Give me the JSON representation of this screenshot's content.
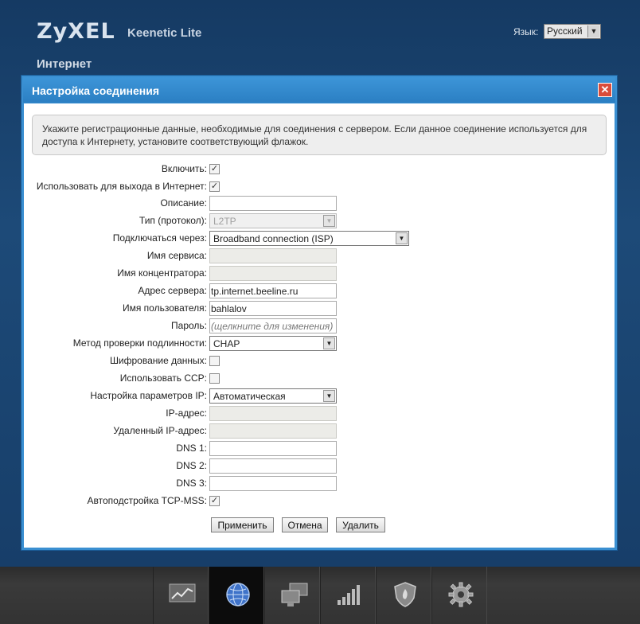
{
  "header": {
    "logo": "ZyXEL",
    "model": "Keenetic Lite",
    "language_label": "Язык:",
    "language_value": "Русский",
    "section": "Интернет"
  },
  "dialog": {
    "title": "Настройка соединения",
    "close": "✕",
    "notice": "Укажите регистрационные данные, необходимые для соединения с сервером. Если данное соединение используется для доступа к Интернету, установите соответствующий флажок."
  },
  "form": {
    "enable": {
      "label": "Включить:",
      "checked": true
    },
    "use_internet": {
      "label": "Использовать для выхода в Интернет:",
      "checked": true
    },
    "description": {
      "label": "Описание:",
      "value": ""
    },
    "protocol": {
      "label": "Тип (протокол):",
      "value": "L2TP"
    },
    "via": {
      "label": "Подключаться через:",
      "value": "Broadband connection (ISP)"
    },
    "service_name": {
      "label": "Имя сервиса:",
      "value": ""
    },
    "concentrator": {
      "label": "Имя концентратора:",
      "value": ""
    },
    "server": {
      "label": "Адрес сервера:",
      "value": "tp.internet.beeline.ru"
    },
    "username": {
      "label": "Имя пользователя:",
      "value": "bahlalov"
    },
    "password": {
      "label": "Пароль:",
      "placeholder": "(щелкните для изменения)"
    },
    "auth": {
      "label": "Метод проверки подлинности:",
      "value": "CHAP"
    },
    "encryption": {
      "label": "Шифрование данных:",
      "checked": false
    },
    "ccp": {
      "label": "Использовать CCP:",
      "checked": false
    },
    "ip_settings": {
      "label": "Настройка параметров IP:",
      "value": "Автоматическая"
    },
    "ip": {
      "label": "IP-адрес:",
      "value": ""
    },
    "remote_ip": {
      "label": "Удаленный IP-адрес:",
      "value": ""
    },
    "dns1": {
      "label": "DNS 1:",
      "value": ""
    },
    "dns2": {
      "label": "DNS 2:",
      "value": ""
    },
    "dns3": {
      "label": "DNS 3:",
      "value": ""
    },
    "tcp_mss": {
      "label": "Автоподстройка TCP-MSS:",
      "checked": true
    }
  },
  "buttons": {
    "apply": "Применить",
    "cancel": "Отмена",
    "delete": "Удалить"
  },
  "taskbar": {
    "items": [
      {
        "icon": "chart-icon",
        "active": false
      },
      {
        "icon": "globe-icon",
        "active": true
      },
      {
        "icon": "network-icon",
        "active": false
      },
      {
        "icon": "signal-icon",
        "active": false
      },
      {
        "icon": "shield-icon",
        "active": false
      },
      {
        "icon": "gear-icon",
        "active": false
      }
    ]
  }
}
